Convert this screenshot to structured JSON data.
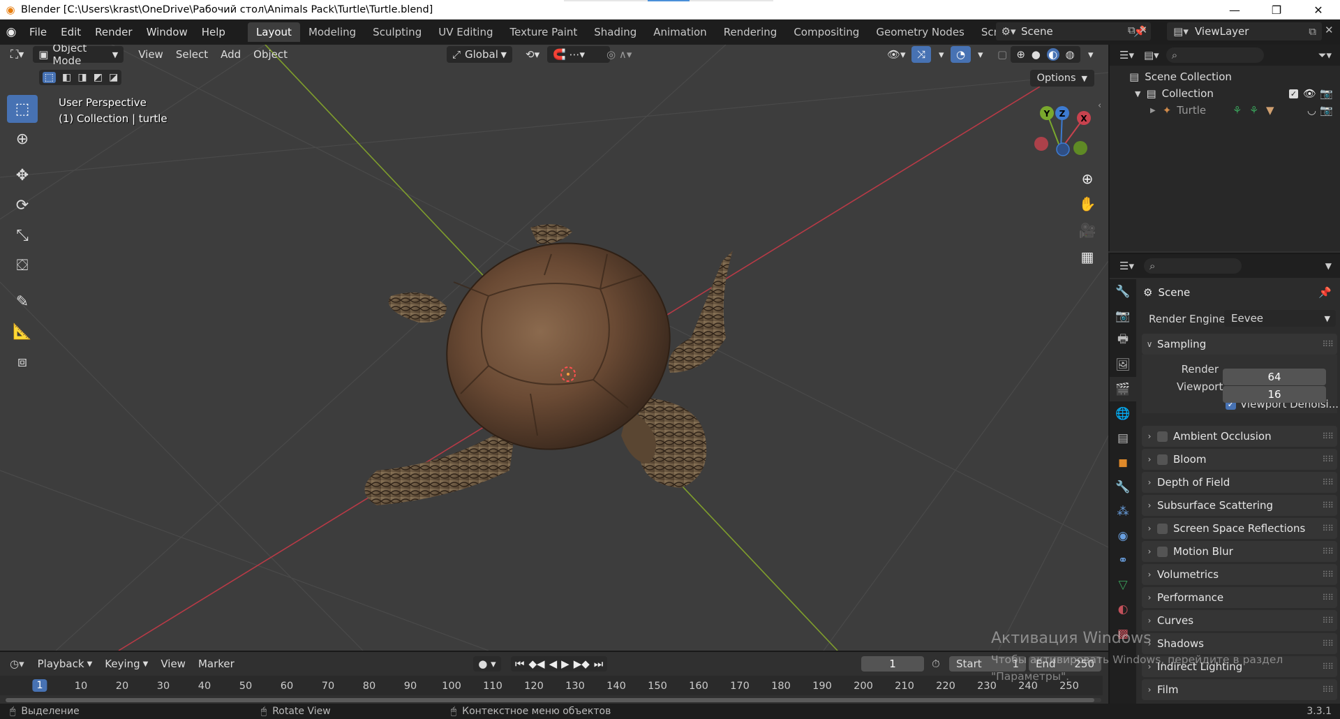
{
  "titlebar": {
    "title": "Blender [C:\\Users\\krast\\OneDrive\\Рабочий стол\\Animals Pack\\Turtle\\Turtle.blend]",
    "minimize": "—",
    "restore": "❐",
    "close": "✕"
  },
  "menu": [
    "File",
    "Edit",
    "Render",
    "Window",
    "Help"
  ],
  "workspaces": [
    "Layout",
    "Modeling",
    "Sculpting",
    "UV Editing",
    "Texture Paint",
    "Shading",
    "Animation",
    "Rendering",
    "Compositing",
    "Geometry Nodes",
    "Scripting"
  ],
  "active_workspace": "Layout",
  "add_workspace": "+",
  "scene_name": "Scene",
  "view_layer_name": "ViewLayer",
  "viewport_header": {
    "mode": "Object Mode",
    "menus": [
      "View",
      "Select",
      "Add",
      "Object"
    ],
    "transform_orientation": "Global",
    "options": "Options"
  },
  "viewport_info": {
    "perspective": "User Perspective",
    "collection": "(1) Collection | turtle"
  },
  "gizmo": {
    "x": "X",
    "y": "Y",
    "z": "Z"
  },
  "colors": {
    "accent": "#4772b3",
    "x_axis": "#c8424e",
    "y_axis": "#7aa82d",
    "z_axis": "#3d7bd1",
    "checkbox_on": "#4772b3"
  },
  "outliner": {
    "scene_collection": "Scene Collection",
    "collection": "Collection",
    "object": "Turtle"
  },
  "properties": {
    "context": "Scene",
    "render_engine_label": "Render Engine",
    "render_engine": "Eevee",
    "sampling": "Sampling",
    "render_label": "Render",
    "render_samples": "64",
    "viewport_label": "Viewport",
    "viewport_samples": "16",
    "viewport_denoising": "Viewport Denoisi...",
    "panels": [
      "Ambient Occlusion",
      "Bloom",
      "Depth of Field",
      "Subsurface Scattering",
      "Screen Space Reflections",
      "Motion Blur",
      "Volumetrics",
      "Performance",
      "Curves",
      "Shadows",
      "Indirect Lighting",
      "Film"
    ]
  },
  "timeline": {
    "menus": [
      "Playback",
      "Keying",
      "View",
      "Marker"
    ],
    "current_frame": "1",
    "start_label": "Start",
    "start": "1",
    "end_label": "End",
    "end": "250",
    "ticks": [
      "1",
      "10",
      "20",
      "30",
      "40",
      "50",
      "60",
      "70",
      "80",
      "90",
      "100",
      "110",
      "120",
      "130",
      "140",
      "150",
      "160",
      "170",
      "180",
      "190",
      "200",
      "210",
      "220",
      "230",
      "240",
      "250"
    ]
  },
  "statusbar": {
    "select": "Выделение",
    "rotate": "Rotate View",
    "context": "Контекстное меню объектов",
    "version": "3.3.1"
  },
  "watermark": {
    "title": "Активация Windows",
    "line1": "Чтобы активировать Windows, перейдите в раздел",
    "line2": "\"Параметры\"."
  }
}
